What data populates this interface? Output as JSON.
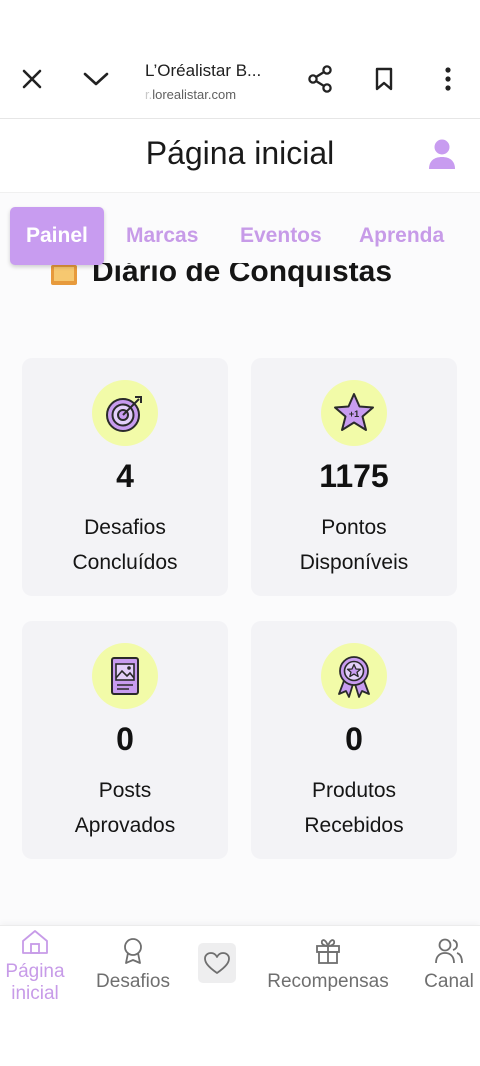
{
  "browser": {
    "title": "L’Oréalistar B...",
    "url_prefix": "r.",
    "url_domain": "lorealistar.com"
  },
  "header": {
    "title": "Página inicial"
  },
  "tabs": [
    {
      "label": "Painel",
      "active": true
    },
    {
      "label": "Marcas"
    },
    {
      "label": "Eventos"
    },
    {
      "label": "Aprenda"
    }
  ],
  "section": {
    "title": "Diário de Conquistas",
    "icon": "book-icon"
  },
  "cards": [
    {
      "value": "4",
      "line1": "Desafios",
      "line2": "Concluídos",
      "icon": "target-icon"
    },
    {
      "value": "1175",
      "line1": "Pontos",
      "line2": "Disponíveis",
      "icon": "star-plus-one-icon"
    },
    {
      "value": "0",
      "line1": "Posts",
      "line2": "Aprovados",
      "icon": "post-image-icon"
    },
    {
      "value": "0",
      "line1": "Produtos",
      "line2": "Recebidos",
      "icon": "award-ribbon-icon"
    }
  ],
  "nav": [
    {
      "line1": "Página",
      "line2": "inicial",
      "icon": "home-icon",
      "active": true
    },
    {
      "line1": "Desafios",
      "icon": "medal-icon"
    },
    {
      "icon": "heart-icon"
    },
    {
      "line1": "Recompensas",
      "icon": "gift-icon"
    },
    {
      "line1": "Canal",
      "icon": "users-icon"
    }
  ],
  "colors": {
    "accent": "#c89cf0",
    "badge": "#f2fba8",
    "card": "#f3f3f6",
    "nav_inactive": "#6f6f6f"
  }
}
